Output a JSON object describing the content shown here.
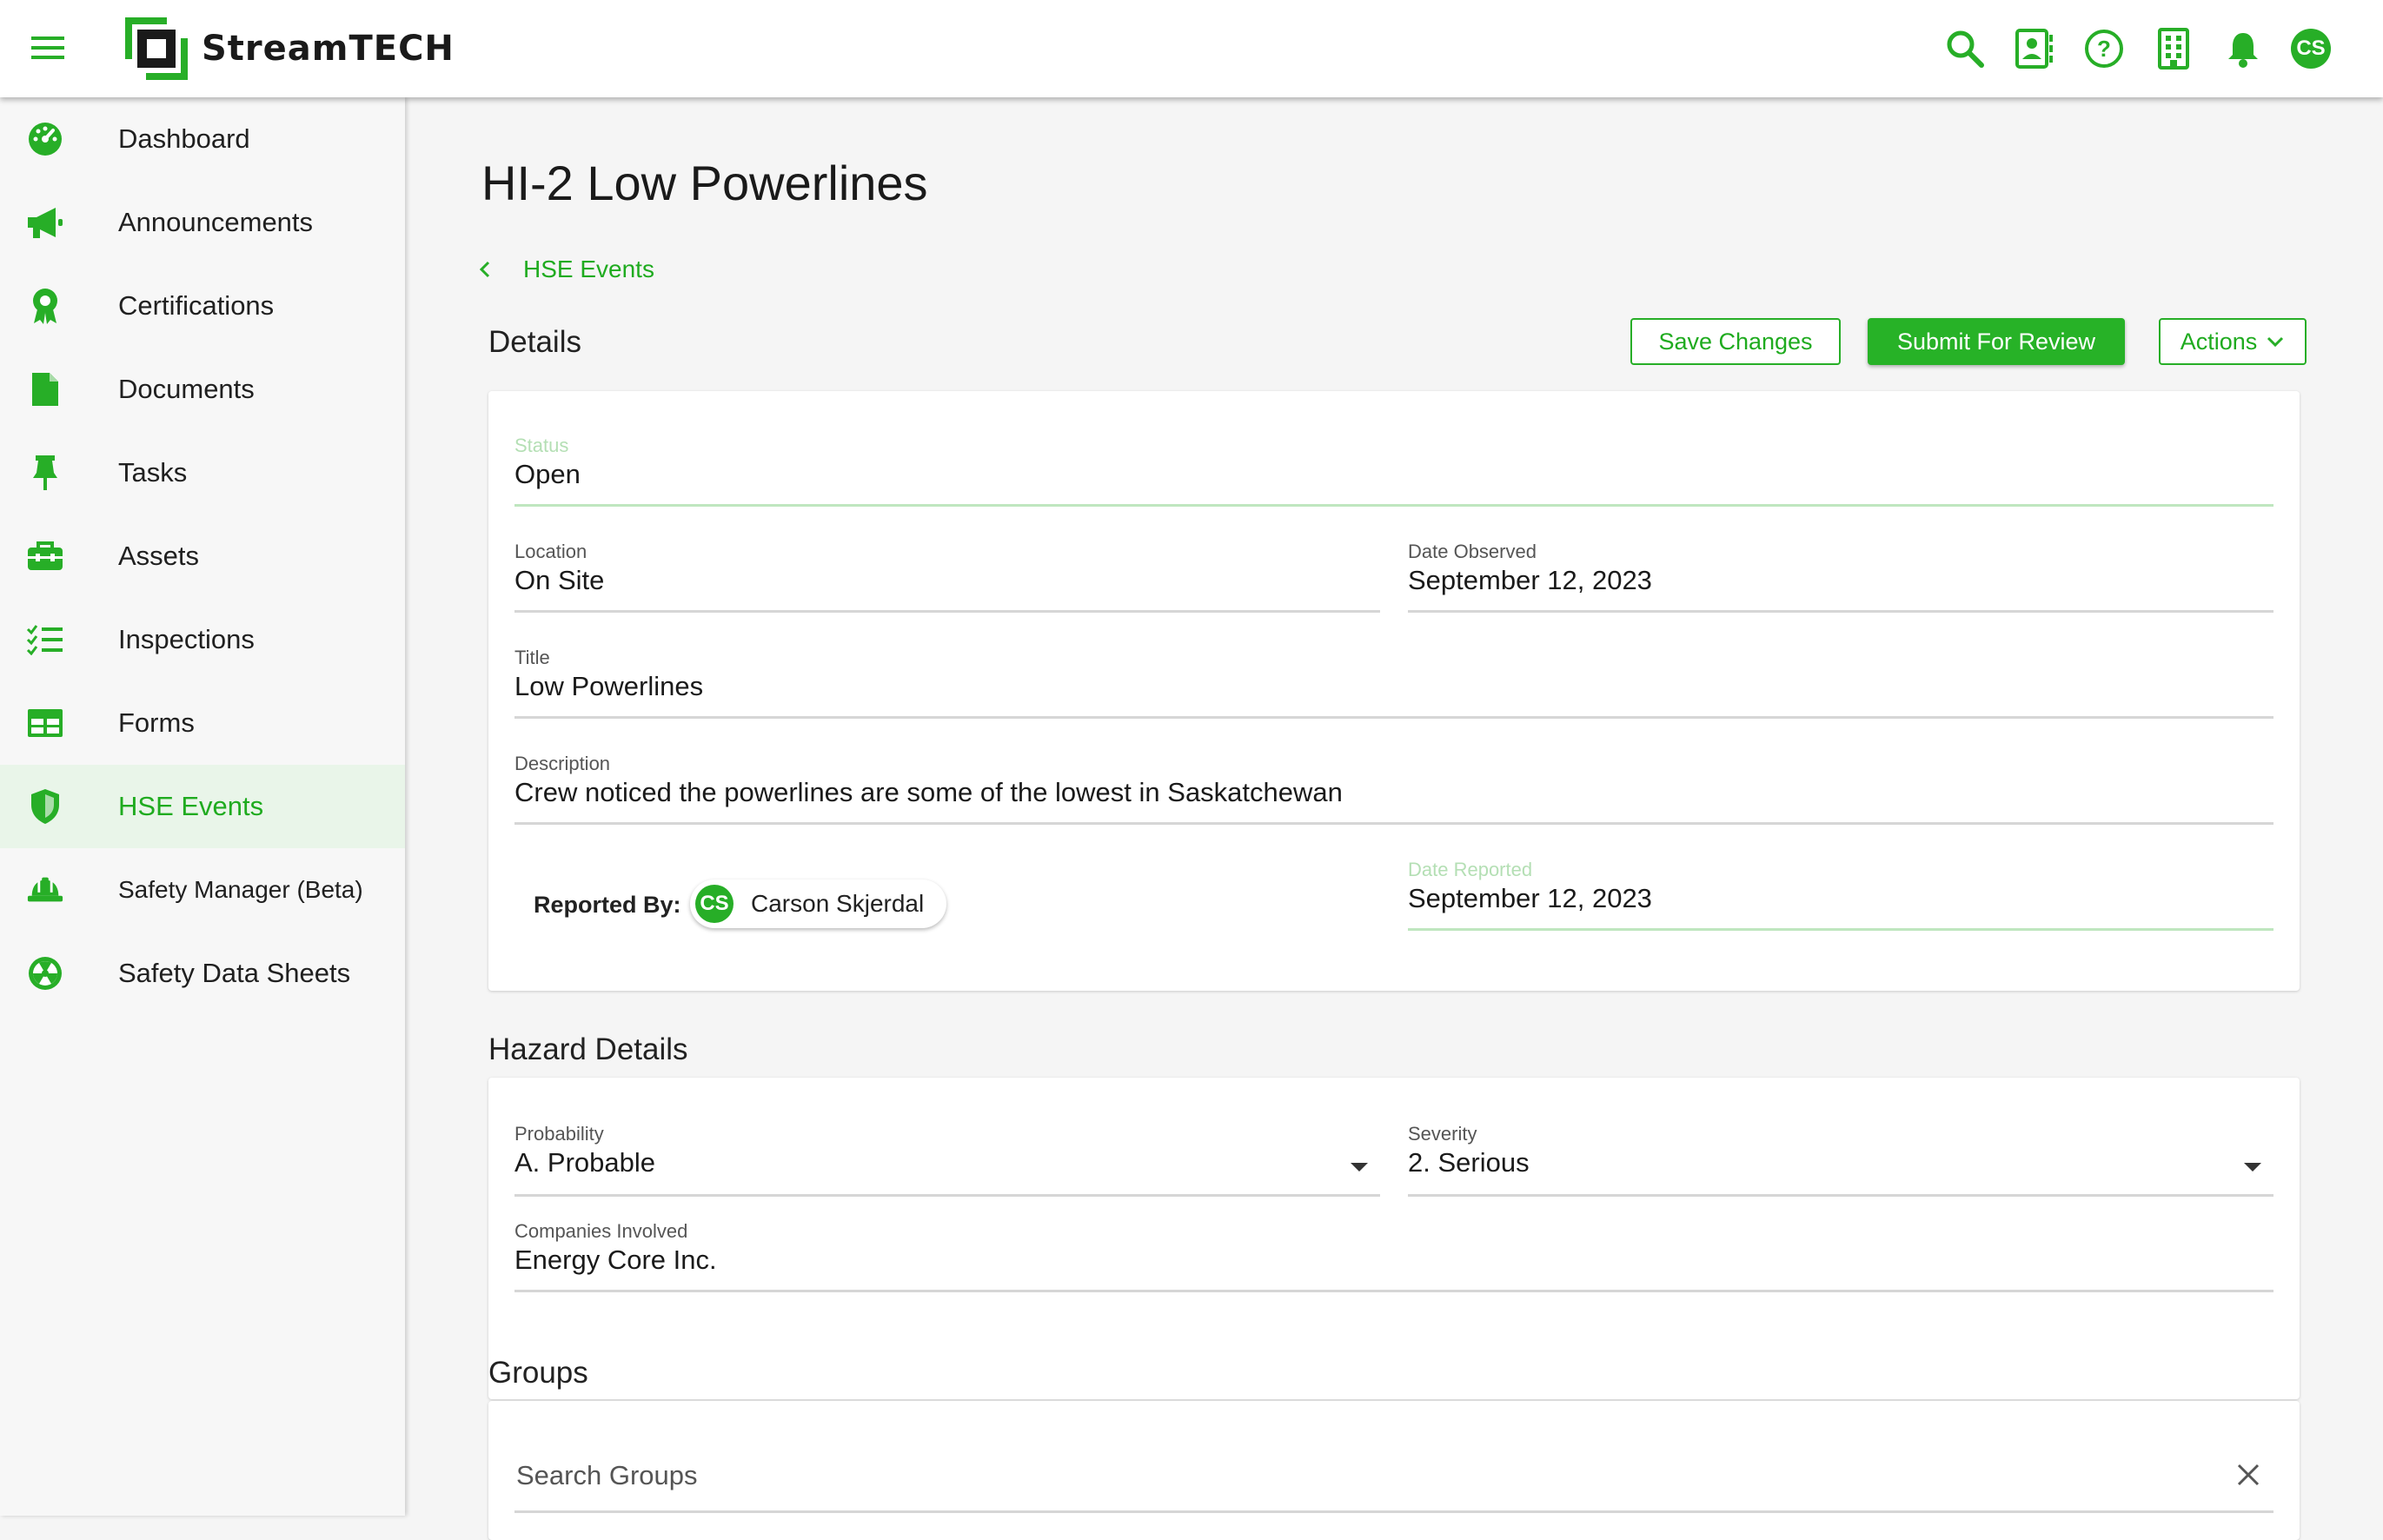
{
  "header": {
    "brand": "StreamTECH",
    "user_initials": "CS",
    "icons": [
      "search-icon",
      "contact-card-icon",
      "help-icon",
      "building-icon",
      "bell-icon"
    ]
  },
  "sidebar": {
    "items": [
      {
        "label": "Dashboard",
        "icon": "dashboard-icon"
      },
      {
        "label": "Announcements",
        "icon": "megaphone-icon"
      },
      {
        "label": "Certifications",
        "icon": "award-icon"
      },
      {
        "label": "Documents",
        "icon": "document-icon"
      },
      {
        "label": "Tasks",
        "icon": "pin-icon"
      },
      {
        "label": "Assets",
        "icon": "toolbox-icon"
      },
      {
        "label": "Inspections",
        "icon": "checklist-icon"
      },
      {
        "label": "Forms",
        "icon": "table-icon"
      },
      {
        "label": "HSE Events",
        "icon": "shield-icon"
      },
      {
        "label": "Safety Manager (Beta)",
        "icon": "hardhat-icon"
      },
      {
        "label": "Safety Data Sheets",
        "icon": "hazard-icon"
      }
    ],
    "active": "HSE Events"
  },
  "page": {
    "title": "HI-2 Low Powerlines",
    "breadcrumb": "HSE Events"
  },
  "details": {
    "section_title": "Details",
    "buttons": {
      "save": "Save Changes",
      "submit": "Submit For Review",
      "actions": "Actions"
    },
    "status": {
      "label": "Status",
      "value": "Open"
    },
    "location": {
      "label": "Location",
      "value": "On Site"
    },
    "date_observed": {
      "label": "Date Observed",
      "value": "September 12, 2023"
    },
    "title_field": {
      "label": "Title",
      "value": "Low Powerlines"
    },
    "description": {
      "label": "Description",
      "value": "Crew noticed the powerlines are some of the lowest in Saskatchewan"
    },
    "reported_by": {
      "label": "Reported By:",
      "initials": "CS",
      "name": "Carson Skjerdal"
    },
    "date_reported": {
      "label": "Date Reported",
      "value": "September 12, 2023"
    }
  },
  "hazard": {
    "section_title": "Hazard Details",
    "probability": {
      "label": "Probability",
      "value": "A. Probable"
    },
    "severity": {
      "label": "Severity",
      "value": "2. Serious"
    },
    "companies": {
      "label": "Companies Involved",
      "value": "Energy Core Inc."
    }
  },
  "groups": {
    "section_title": "Groups",
    "search_placeholder": "Search Groups"
  },
  "colors": {
    "accent": "#27ae27",
    "accent_text": "#1fab1f",
    "active_bg": "#e9f5e9"
  }
}
